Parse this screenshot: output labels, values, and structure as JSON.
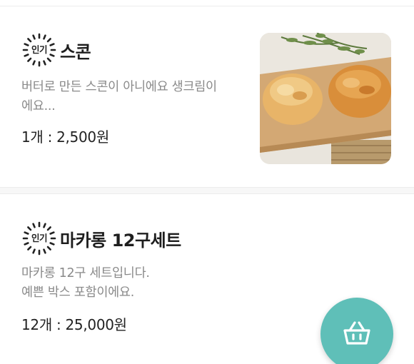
{
  "items": [
    {
      "badge": "인기",
      "title": "스콘",
      "description_lines": [
        "버터로 만든 스콘이 아니에요 생크림이",
        "에요..."
      ],
      "price": "1개 : 2,500원",
      "image_icon": "scone-photo"
    },
    {
      "badge": "인기",
      "title": "마카롱 12구세트",
      "description_lines": [
        "마카롱 12구 세트입니다.",
        "예쁜 박스 포함이에요."
      ],
      "price": "12개 : 25,000원"
    }
  ],
  "cart_button": {
    "icon": "basket-icon",
    "color": "#5fbfb8"
  }
}
